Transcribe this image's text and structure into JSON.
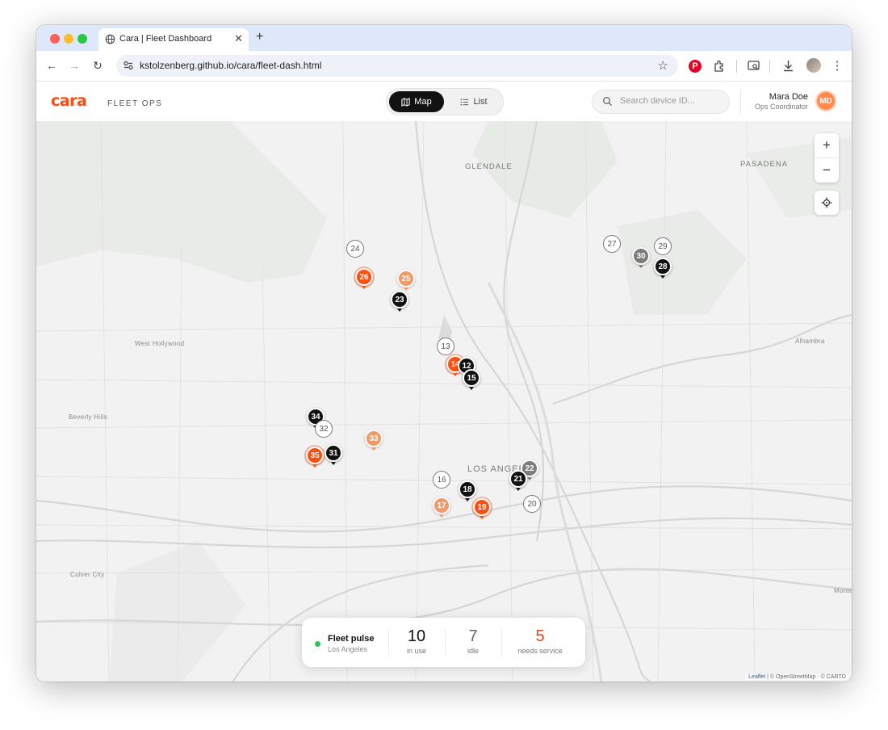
{
  "browser": {
    "tab_title": "Cara | Fleet Dashboard",
    "url": "kstolzenberg.github.io/cara/fleet-dash.html"
  },
  "header": {
    "logo": "cara",
    "tagline": "FLEET OPS",
    "view_toggle": {
      "map_label": "Map",
      "list_label": "List",
      "active": "Map"
    },
    "search_placeholder": "Search device ID...",
    "user": {
      "name": "Mara Doe",
      "role": "Ops Coordinator",
      "initials": "MD"
    }
  },
  "map": {
    "places": {
      "glendale": "GLENDALE",
      "pasadena": "PASADENA",
      "west_hollywood": "West Hollywood",
      "alhambra": "Alhambra",
      "beverly_hills": "Beverly Hills",
      "los_angeles": "LOS ANGELES",
      "culver_city": "Culver City",
      "monte": "Monte"
    },
    "markers": [
      {
        "id": "24",
        "status": "white"
      },
      {
        "id": "26",
        "status": "red"
      },
      {
        "id": "25",
        "status": "orange"
      },
      {
        "id": "23",
        "status": "black"
      },
      {
        "id": "27",
        "status": "white"
      },
      {
        "id": "30",
        "status": "gray"
      },
      {
        "id": "29",
        "status": "white"
      },
      {
        "id": "28",
        "status": "black"
      },
      {
        "id": "13",
        "status": "white"
      },
      {
        "id": "14",
        "status": "red"
      },
      {
        "id": "12",
        "status": "black"
      },
      {
        "id": "15",
        "status": "black"
      },
      {
        "id": "34",
        "status": "black"
      },
      {
        "id": "32",
        "status": "white"
      },
      {
        "id": "33",
        "status": "orange"
      },
      {
        "id": "35",
        "status": "red"
      },
      {
        "id": "31",
        "status": "black"
      },
      {
        "id": "22",
        "status": "gray"
      },
      {
        "id": "21",
        "status": "black"
      },
      {
        "id": "16",
        "status": "white"
      },
      {
        "id": "18",
        "status": "black"
      },
      {
        "id": "17",
        "status": "orange"
      },
      {
        "id": "19",
        "status": "red"
      },
      {
        "id": "20",
        "status": "white"
      }
    ],
    "controls": {
      "zoom_in": "+",
      "zoom_out": "−"
    },
    "attribution": {
      "leaflet": "Leaflet",
      "rest": " | © OpenStreetMap · © CARTO"
    }
  },
  "fleet_pulse": {
    "title": "Fleet pulse",
    "city": "Los Angeles",
    "in_use": {
      "value": "10",
      "label": "in use"
    },
    "idle": {
      "value": "7",
      "label": "idle"
    },
    "needs_service": {
      "value": "5",
      "label": "needs service"
    }
  },
  "colors": {
    "brand": "#ff4a12",
    "needs_service": "#e5431b",
    "status_ok": "#2ec25a",
    "marker_red": "#ff4e10",
    "marker_orange": "#ee9a6a",
    "marker_gray": "#7c7c7c",
    "marker_black": "#111111"
  }
}
